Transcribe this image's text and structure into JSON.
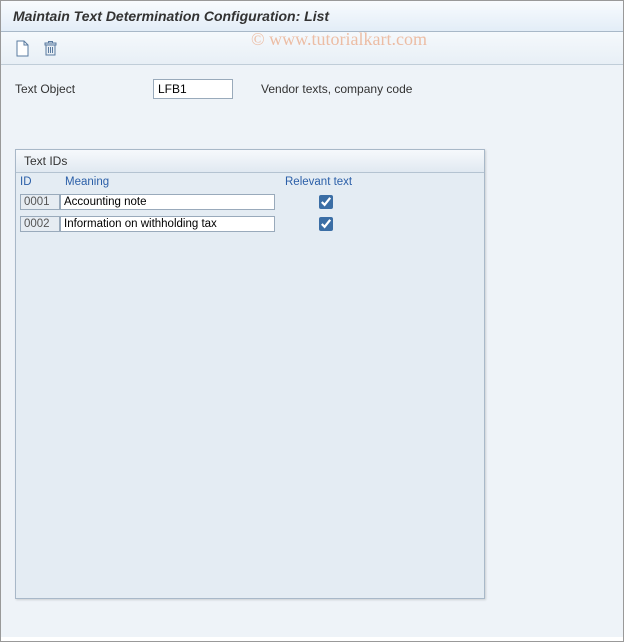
{
  "title": "Maintain Text Determination Configuration: List",
  "toolbar": {
    "new_icon": "new-document",
    "delete_icon": "trash"
  },
  "watermark": "© www.tutorialkart.com",
  "textObject": {
    "label": "Text Object",
    "value": "LFB1",
    "description": "Vendor texts, company code"
  },
  "panel": {
    "title": "Text IDs",
    "columns": {
      "id": "ID",
      "meaning": "Meaning",
      "relevant": "Relevant text"
    },
    "rows": [
      {
        "id": "0001",
        "meaning": "Accounting note",
        "relevant": true
      },
      {
        "id": "0002",
        "meaning": "Information on withholding tax",
        "relevant": true
      }
    ]
  }
}
